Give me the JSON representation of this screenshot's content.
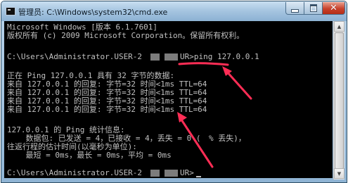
{
  "window": {
    "title": "管理员: C:\\Windows\\system32\\cmd.exe",
    "minimize_label": "",
    "maximize_label": "",
    "close_label": "✕"
  },
  "console": {
    "lines": [
      {
        "id": "l0",
        "text": "Microsoft Windows [版本 6.1.7601]"
      },
      {
        "id": "l1",
        "text": "版权所有 (c) 2009 Microsoft Corporation。保留所有权利。"
      },
      {
        "id": "l2",
        "text": ""
      },
      {
        "id": "l3a",
        "text": "C:\\Users\\Administrator.USER-2"
      },
      {
        "id": "l3b",
        "text": "UR>ping 127.0.0.1"
      },
      {
        "id": "l4",
        "text": ""
      },
      {
        "id": "l5",
        "text": "正在 Ping 127.0.0.1 具有 32 字节的数据:"
      },
      {
        "id": "l6",
        "text": "来自 127.0.0.1 的回复: 字节=32 时间<1ms TTL=64"
      },
      {
        "id": "l7",
        "text": "来自 127.0.0.1 的回复: 字节=32 时间<1ms TTL=64"
      },
      {
        "id": "l8",
        "text": "来自 127.0.0.1 的回复: 字节=32 时间<1ms TTL=64"
      },
      {
        "id": "l9",
        "text": "来自 127.0.0.1 的回复: 字节=32 时间<1ms TTL=64"
      },
      {
        "id": "l10",
        "text": ""
      },
      {
        "id": "l11",
        "text": "127.0.0.1 的 Ping 统计信息:"
      },
      {
        "id": "l12a",
        "text": "    数据包: 已发送 = 4，已接收 = 4，丢失 = 0 ("
      },
      {
        "id": "l12b",
        "text": "% 丢失)，"
      },
      {
        "id": "l13",
        "text": "往返行程的估计时间(以毫秒为单位):"
      },
      {
        "id": "l14",
        "text": "    最短 = 0ms，最长 = 0ms，平均 = 0ms"
      },
      {
        "id": "l15",
        "text": ""
      },
      {
        "id": "l16a",
        "text": "C:\\Users\\Administrator.USER-2"
      },
      {
        "id": "l16b",
        "text": "UR>"
      }
    ]
  },
  "colors": {
    "console_bg": "#000000",
    "console_fg": "#c0c0c0",
    "annotation": "#ff2d55"
  },
  "icons": {
    "app": "cmd-icon",
    "minimize": "minimize-icon",
    "maximize": "maximize-icon",
    "close": "close-icon"
  }
}
